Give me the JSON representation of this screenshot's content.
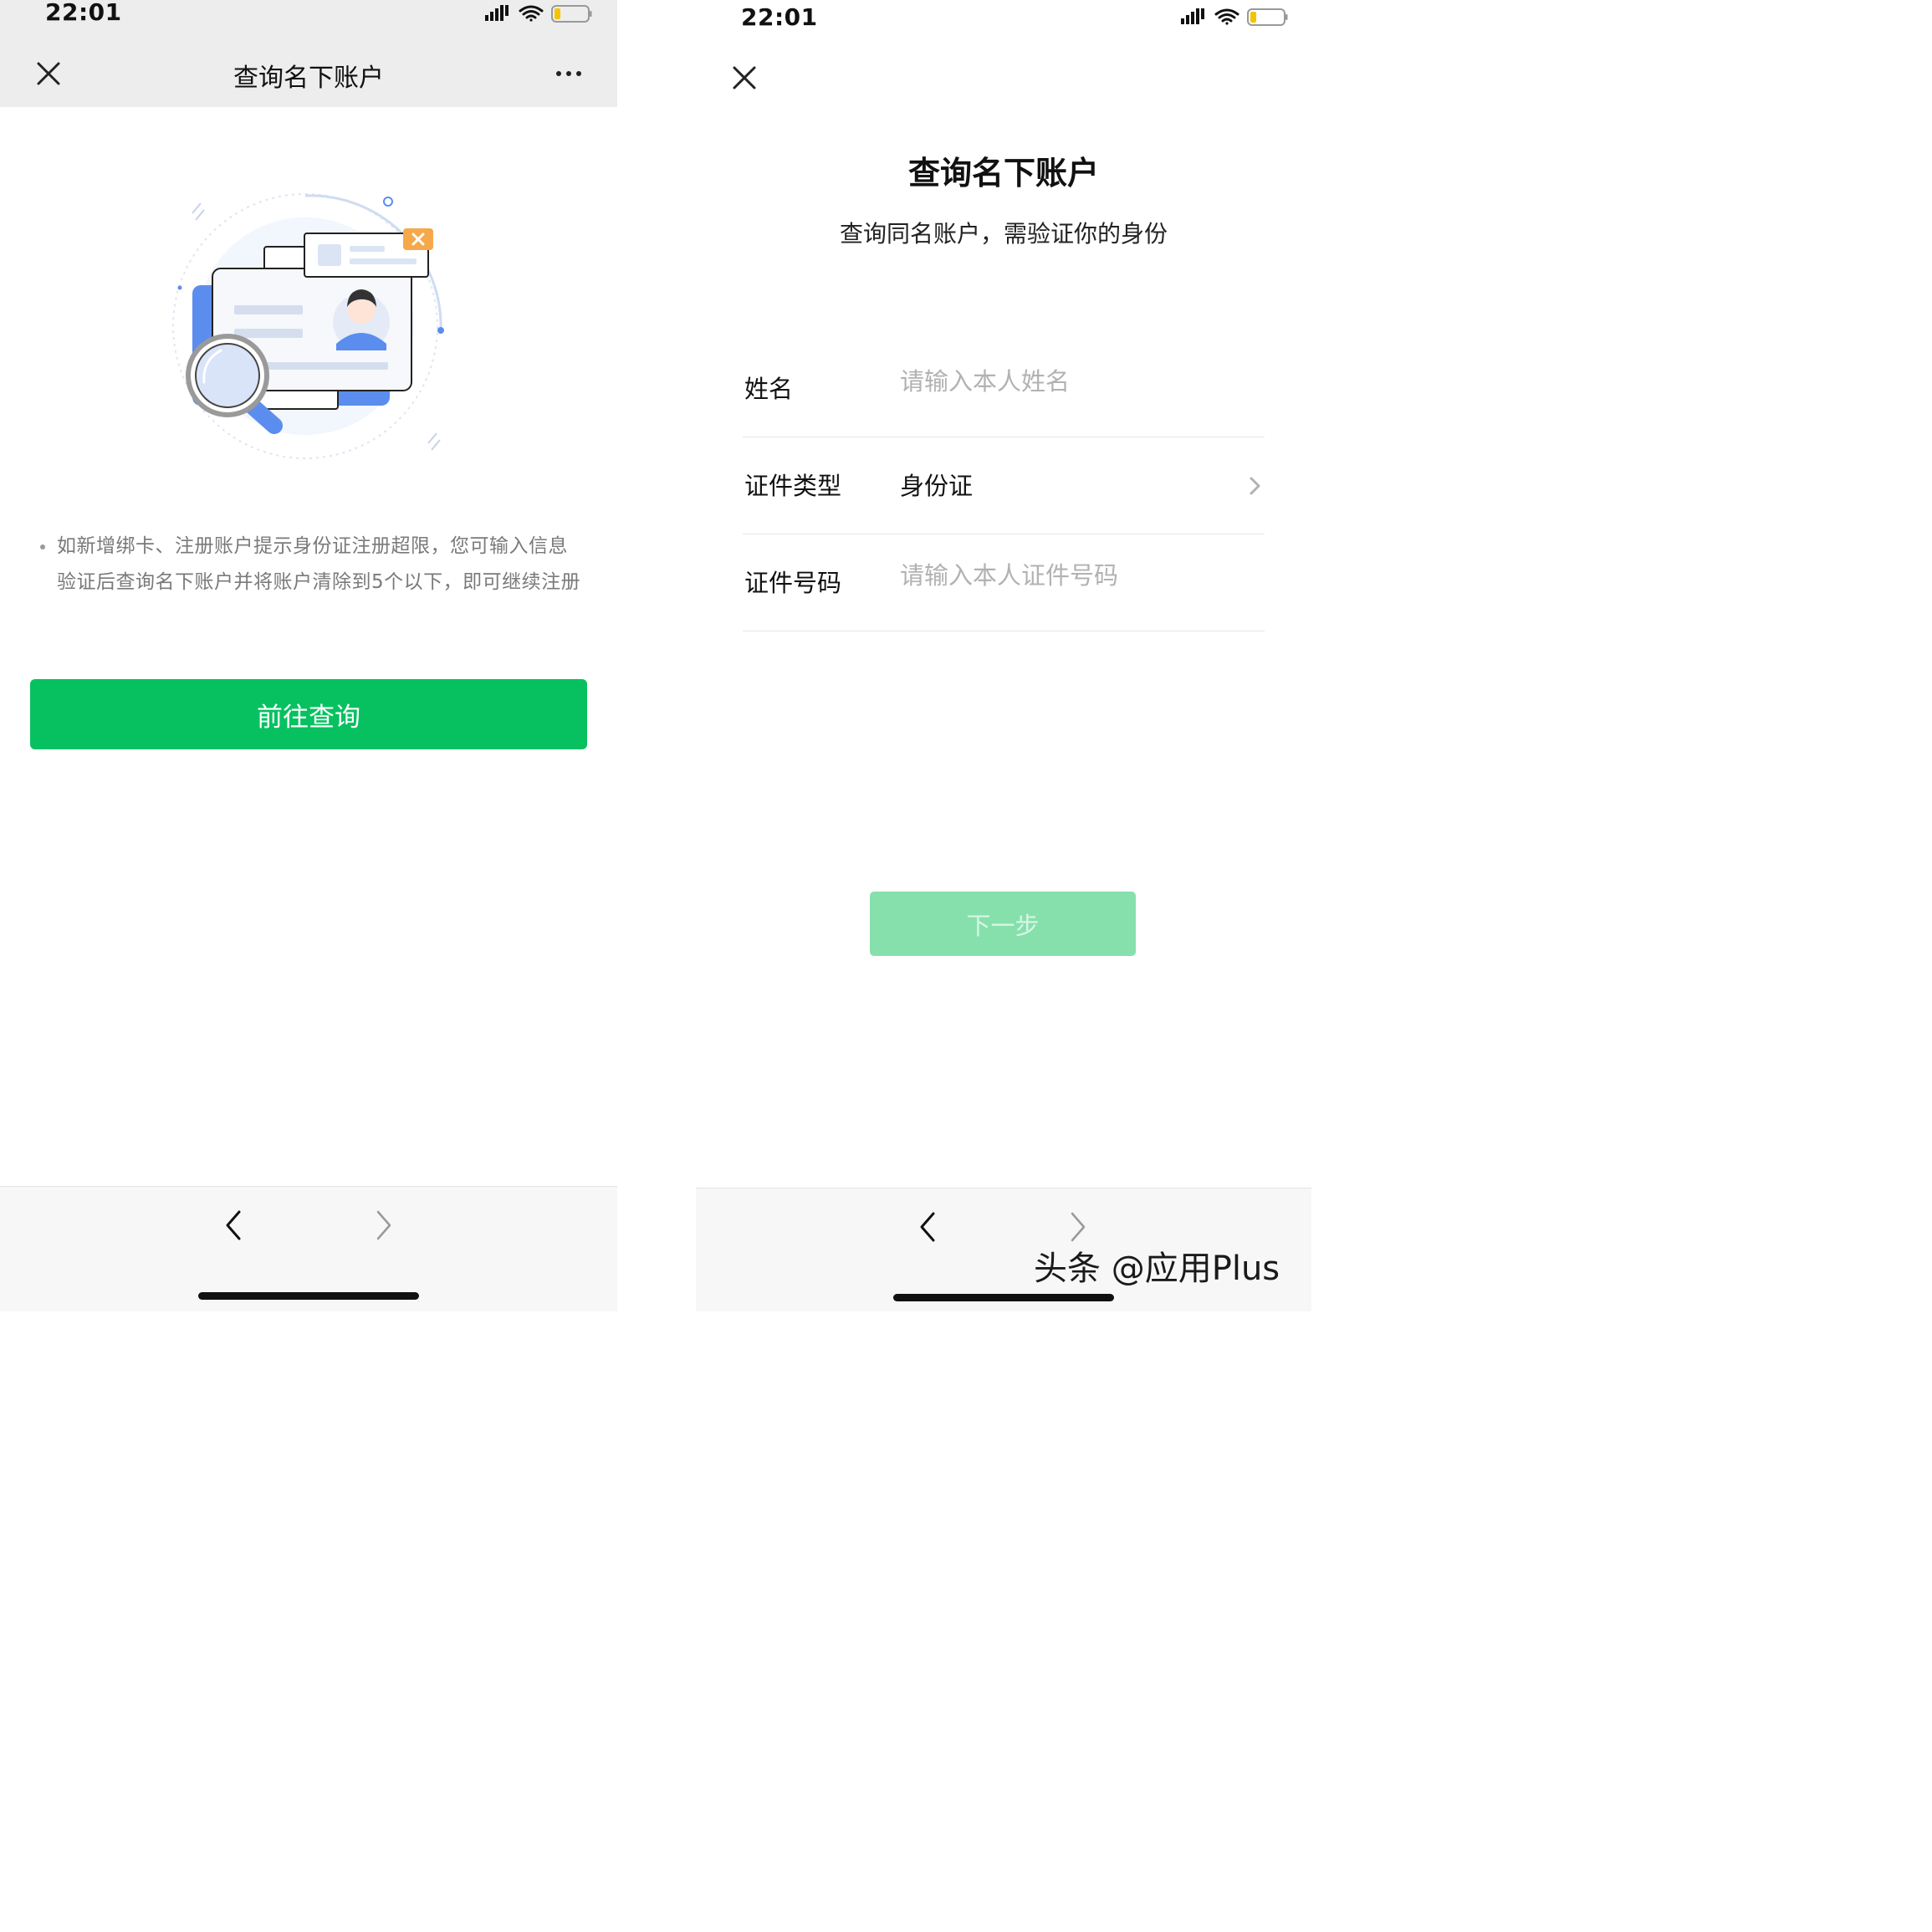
{
  "left": {
    "status": {
      "time": "22:01"
    },
    "navbar": {
      "title": "查询名下账户"
    },
    "notice": {
      "text": "如新增绑卡、注册账户提示身份证注册超限，您可输入信息验证后查询名下账户并将账户清除到5个以下，即可继续注册"
    },
    "primary_button": {
      "label": "前往查询"
    },
    "icons": [
      "close-icon",
      "more-icon",
      "back-arrow-icon",
      "forward-arrow-icon",
      "id-card-search-illustration"
    ],
    "colors": {
      "primary": "#07c160",
      "illustration_blue": "#5b8def",
      "badge_orange": "#f5a94a"
    }
  },
  "right": {
    "status": {
      "time": "22:01"
    },
    "title": "查询名下账户",
    "subtitle": "查询同名账户，需验证你的身份",
    "form": {
      "name": {
        "label": "姓名",
        "placeholder": "请输入本人姓名"
      },
      "id_type": {
        "label": "证件类型",
        "value": "身份证"
      },
      "id_number": {
        "label": "证件号码",
        "placeholder": "请输入本人证件号码"
      }
    },
    "next_button": {
      "label": "下一步"
    },
    "icons": [
      "close-icon",
      "chevron-right-icon",
      "back-arrow-icon",
      "forward-arrow-icon"
    ],
    "colors": {
      "disabled_button": "#86e0ac"
    }
  },
  "watermark": "头条 @应用Plus"
}
